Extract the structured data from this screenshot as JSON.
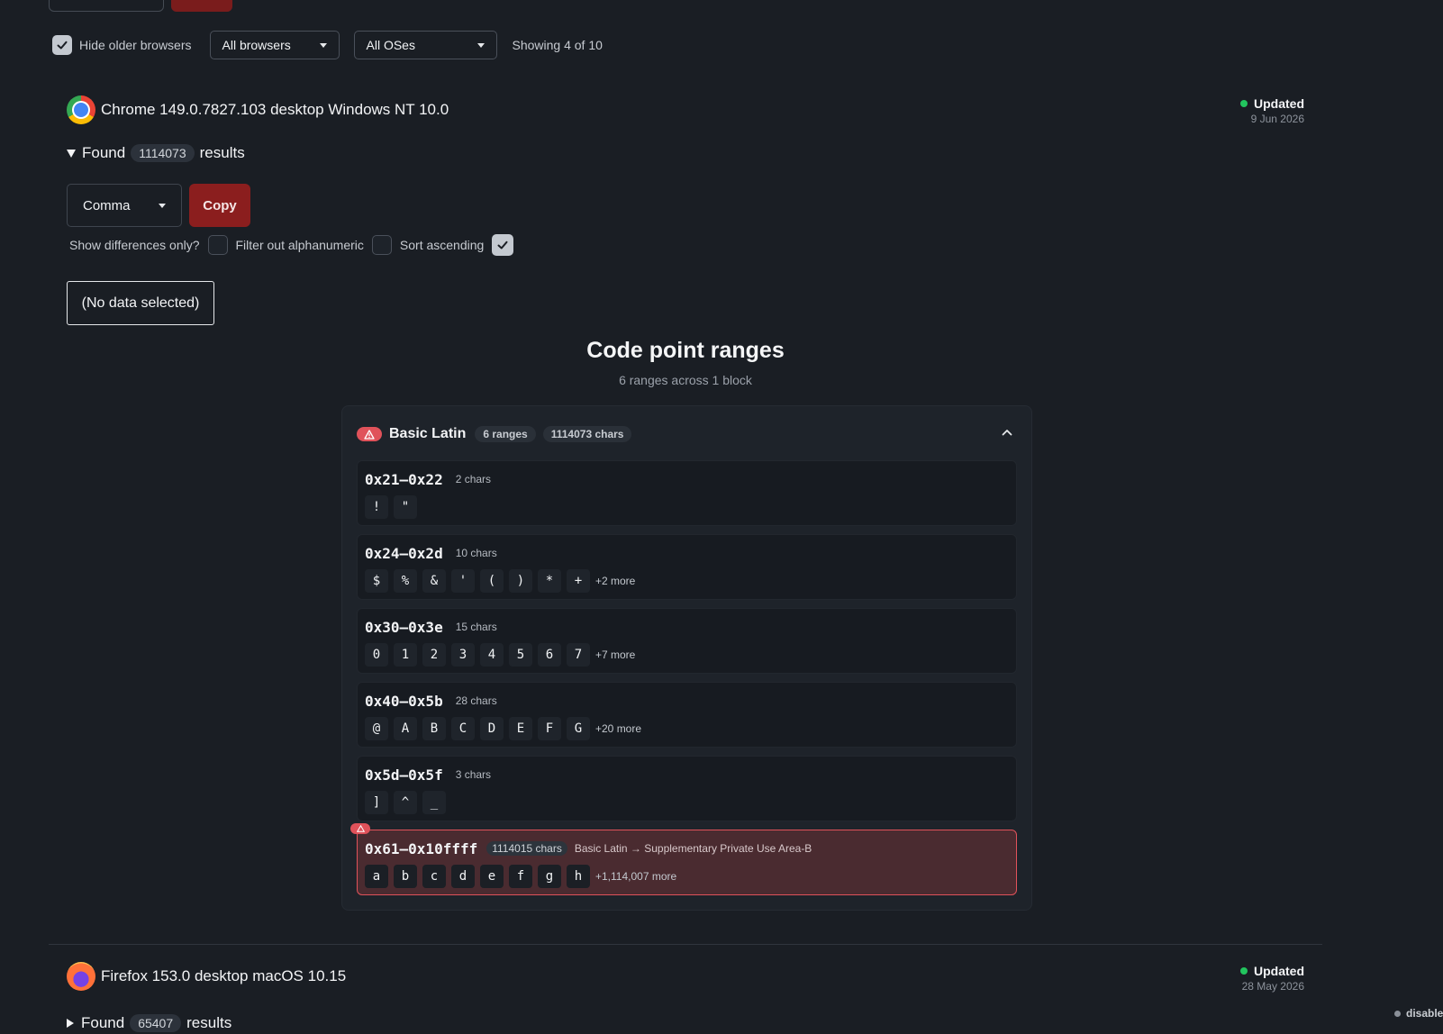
{
  "filters": {
    "hide_older_label": "Hide older browsers",
    "hide_older_checked": true,
    "browser_select": "All browsers",
    "os_select": "All OSes",
    "showing": "Showing 4 of 10"
  },
  "entries": [
    {
      "browser": "Chrome 149.0.7827.103 desktop Windows NT 10.0",
      "logo_icon": "chrome-icon",
      "updated_label": "Updated",
      "updated_date": "9 Jun 2026",
      "found_prefix": "Found",
      "found_count": "1114073",
      "found_suffix": "results",
      "format_select": "Comma",
      "copy_label": "Copy",
      "options": {
        "show_diff": "Show differences only?",
        "show_diff_checked": false,
        "filter_alnum": "Filter out alphanumeric",
        "filter_alnum_checked": false,
        "sort_asc": "Sort ascending",
        "sort_asc_checked": true
      },
      "selection": "(No data selected)",
      "code_points": {
        "title": "Code point ranges",
        "subtitle": "6 ranges across 1 block",
        "block": {
          "name": "Basic Latin",
          "ranges_pill": "6 ranges",
          "chars_pill": "1114073 chars",
          "warning": true
        },
        "ranges": [
          {
            "name": "0x21–0x22",
            "count": "2 chars",
            "chars": [
              "!",
              "\""
            ],
            "more": ""
          },
          {
            "name": "0x24–0x2d",
            "count": "10 chars",
            "chars": [
              "$",
              "%",
              "&",
              "'",
              "(",
              ")",
              "*",
              "+"
            ],
            "more": "+2 more"
          },
          {
            "name": "0x30–0x3e",
            "count": "15 chars",
            "chars": [
              "0",
              "1",
              "2",
              "3",
              "4",
              "5",
              "6",
              "7"
            ],
            "more": "+7 more"
          },
          {
            "name": "0x40–0x5b",
            "count": "28 chars",
            "chars": [
              "@",
              "A",
              "B",
              "C",
              "D",
              "E",
              "F",
              "G"
            ],
            "more": "+20 more"
          },
          {
            "name": "0x5d–0x5f",
            "count": "3 chars",
            "chars": [
              "]",
              "^",
              "_"
            ],
            "more": ""
          },
          {
            "name": "0x61–0x10ffff",
            "count": "1114015 chars",
            "note": "Basic Latin → Supplementary Private Use Area-B",
            "chars": [
              "a",
              "b",
              "c",
              "d",
              "e",
              "f",
              "g",
              "h"
            ],
            "more": "+1,114,007 more",
            "warning": true
          }
        ]
      }
    },
    {
      "browser": "Firefox 153.0 desktop macOS 10.15",
      "logo_icon": "firefox-icon",
      "updated_label": "Updated",
      "updated_date": "28 May 2026",
      "found_prefix": "Found",
      "found_count": "65407",
      "found_suffix": "results",
      "status": "disabled"
    }
  ],
  "colors": {
    "background": "#1a1e24",
    "accent_red": "#8b1e1e",
    "warning": "#e0525a",
    "updated_dot": "#22c55e"
  }
}
